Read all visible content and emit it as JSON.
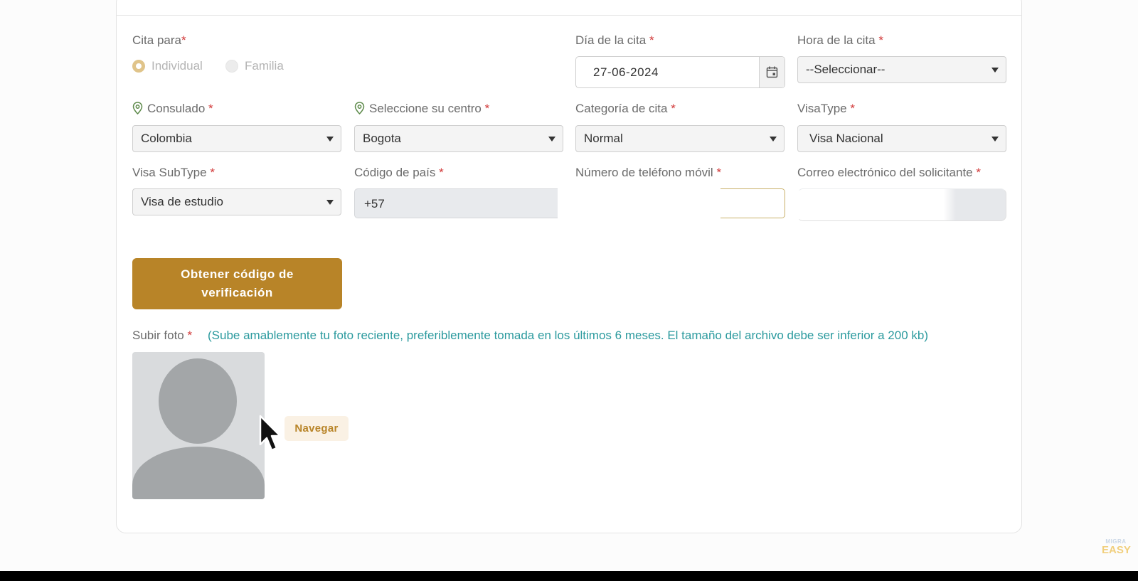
{
  "form": {
    "cita_para": {
      "label": "Cita para",
      "required_mark": "*",
      "options": [
        "Individual",
        "Familia"
      ],
      "selected": "Individual"
    },
    "dia": {
      "label": "Día de la cita",
      "required_mark": "*",
      "value": "27-06-2024"
    },
    "hora": {
      "label": "Hora de la cita",
      "required_mark": "*",
      "value": "--Seleccionar--"
    },
    "consulado": {
      "label": "Consulado",
      "required_mark": "*",
      "value": "Colombia"
    },
    "centro": {
      "label": "Seleccione su centro",
      "required_mark": "*",
      "value": "Bogota"
    },
    "categoria": {
      "label": "Categoría de cita",
      "required_mark": "*",
      "value": "Normal"
    },
    "visatype": {
      "label": "VisaType",
      "required_mark": "*",
      "value": "Visa Nacional"
    },
    "subtype": {
      "label": "Visa SubType",
      "required_mark": "*",
      "value": "Visa de estudio"
    },
    "codigo_pais": {
      "label": "Código de país",
      "required_mark": "*",
      "value": "+57"
    },
    "telefono": {
      "label": "Número de teléfono móvil",
      "required_mark": "*",
      "value": ""
    },
    "correo": {
      "label": "Correo electrónico del solicitante",
      "required_mark": "*",
      "value": ""
    }
  },
  "verify_button": {
    "line1": "Obtener código de",
    "line2": "verificación"
  },
  "photo": {
    "label": "Subir foto",
    "required_mark": "*",
    "hint": "(Sube amablemente tu foto reciente, preferiblemente tomada en los últimos 6 meses. El tamaño del archivo debe ser inferior a 200 kb)",
    "browse_label": "Navegar"
  },
  "watermark": {
    "top": "MIGRA",
    "bottom": "EASY"
  },
  "colors": {
    "accent": "#b88428",
    "hint": "#2b9a9e",
    "required": "#d23a3a"
  },
  "icons": {
    "pin": "location-pin-icon",
    "calendar": "calendar-icon",
    "caret": "caret-down-icon"
  }
}
